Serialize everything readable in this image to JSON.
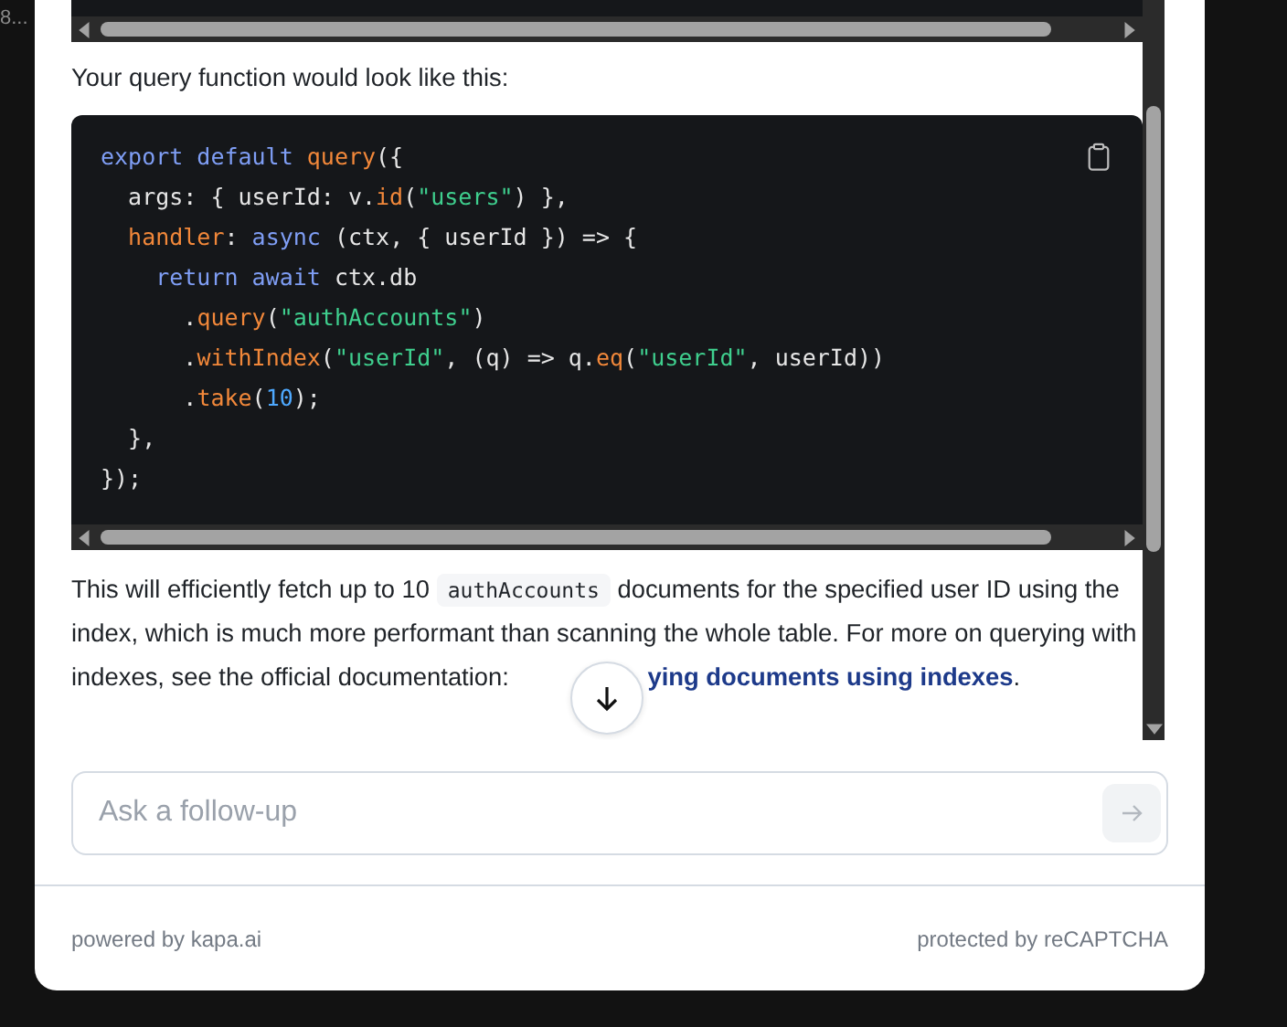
{
  "background": {
    "text": "8..."
  },
  "chat": {
    "intro": "Your query function would look like this:",
    "code": [
      [
        {
          "kind": "keyword",
          "t": "export default "
        },
        {
          "kind": "func",
          "t": "query"
        },
        {
          "kind": "plain",
          "t": "({"
        }
      ],
      [
        {
          "kind": "plain",
          "t": "  args: { userId: v."
        },
        {
          "kind": "func",
          "t": "id"
        },
        {
          "kind": "plain",
          "t": "("
        },
        {
          "kind": "string",
          "t": "\"users\""
        },
        {
          "kind": "plain",
          "t": ") },"
        }
      ],
      [
        {
          "kind": "func",
          "t": "  handler"
        },
        {
          "kind": "plain",
          "t": ": "
        },
        {
          "kind": "keyword",
          "t": "async"
        },
        {
          "kind": "plain",
          "t": " (ctx, { userId }) => {"
        }
      ],
      [
        {
          "kind": "keyword",
          "t": "    return await"
        },
        {
          "kind": "plain",
          "t": " ctx.db"
        }
      ],
      [
        {
          "kind": "plain",
          "t": "      ."
        },
        {
          "kind": "func",
          "t": "query"
        },
        {
          "kind": "plain",
          "t": "("
        },
        {
          "kind": "string",
          "t": "\"authAccounts\""
        },
        {
          "kind": "plain",
          "t": ")"
        }
      ],
      [
        {
          "kind": "plain",
          "t": "      ."
        },
        {
          "kind": "func",
          "t": "withIndex"
        },
        {
          "kind": "plain",
          "t": "("
        },
        {
          "kind": "string",
          "t": "\"userId\""
        },
        {
          "kind": "plain",
          "t": ", (q) => q."
        },
        {
          "kind": "func",
          "t": "eq"
        },
        {
          "kind": "plain",
          "t": "("
        },
        {
          "kind": "string",
          "t": "\"userId\""
        },
        {
          "kind": "plain",
          "t": ", userId))"
        }
      ],
      [
        {
          "kind": "plain",
          "t": "      ."
        },
        {
          "kind": "func",
          "t": "take"
        },
        {
          "kind": "plain",
          "t": "("
        },
        {
          "kind": "number",
          "t": "10"
        },
        {
          "kind": "plain",
          "t": ");"
        }
      ],
      [
        {
          "kind": "plain",
          "t": "  },"
        }
      ],
      [
        {
          "kind": "plain",
          "t": "});"
        }
      ]
    ],
    "answer": {
      "before": "This will efficiently fetch up to 10",
      "code": "authAccounts",
      "after": "documents for the specified user ID using the index, which is much more performant than scanning the whole table. For more on querying with indexes, see the official documentation:",
      "link": "ying documents using indexes",
      "end": "."
    },
    "input": {
      "placeholder": "Ask a follow-up"
    }
  },
  "footer": {
    "left": "powered by kapa.ai",
    "right": "protected by reCAPTCHA"
  }
}
